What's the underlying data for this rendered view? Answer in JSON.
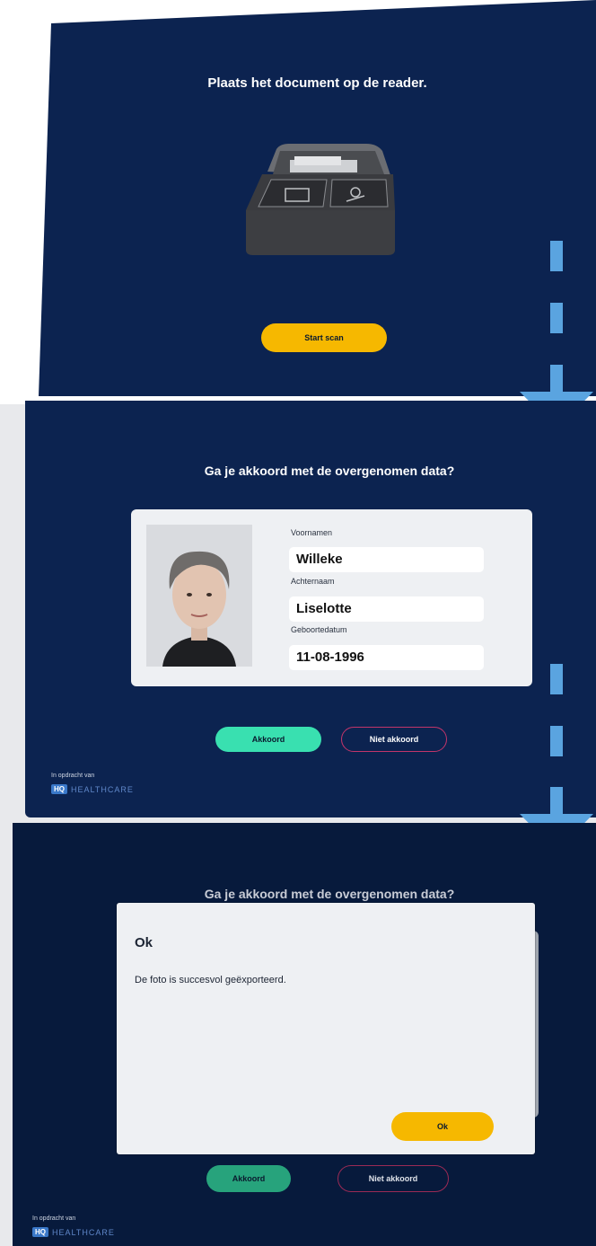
{
  "screen1": {
    "title": "Plaats het document op de reader.",
    "start_button": "Start scan"
  },
  "screen2": {
    "title": "Ga je akkoord met de overgenomen data?",
    "fields": [
      {
        "label": "Voornamen",
        "value": "Willeke"
      },
      {
        "label": "Achternaam",
        "value": "Liselotte"
      },
      {
        "label": "Geboortedatum",
        "value": "11-08-1996"
      }
    ],
    "agree_button": "Akkoord",
    "disagree_button": "Niet akkoord",
    "footer_text": "In opdracht van",
    "logo_badge": "HQ",
    "logo_text": "HEALTHCARE"
  },
  "screen3": {
    "title": "Ga je akkoord met de overgenomen data?",
    "modal": {
      "title": "Ok",
      "message": "De foto is succesvol geëxporteerd.",
      "ok_button": "Ok"
    },
    "agree_button": "Akkoord",
    "disagree_button": "Niet akkoord",
    "footer_text": "In opdracht van",
    "logo_badge": "HQ",
    "logo_text": "HEALTHCARE"
  },
  "colors": {
    "panel_bg": "#0c2350",
    "start_button": "#f6b800",
    "agree_button": "#39e0b0",
    "disagree_border": "#c2356a",
    "arrow": "#5aa4e0"
  },
  "icons": [
    "document-reader-icon",
    "flow-arrow-icon",
    "id-photo"
  ]
}
